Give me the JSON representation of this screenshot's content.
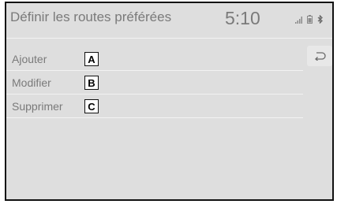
{
  "header": {
    "title": "Définir les routes préférées",
    "clock": "5:10"
  },
  "status_icons": [
    "signal-bars-icon",
    "battery-icon",
    "bluetooth-icon"
  ],
  "menu": {
    "items": [
      {
        "label": "Ajouter",
        "callout": "A"
      },
      {
        "label": "Modifier",
        "callout": "B"
      },
      {
        "label": "Supprimer",
        "callout": "C"
      }
    ]
  },
  "back_button": {
    "icon": "back-arrow-icon"
  },
  "colors": {
    "screen_bg": "#dedede",
    "text": "#7a7a7a",
    "separator": "#f2f2f2"
  }
}
